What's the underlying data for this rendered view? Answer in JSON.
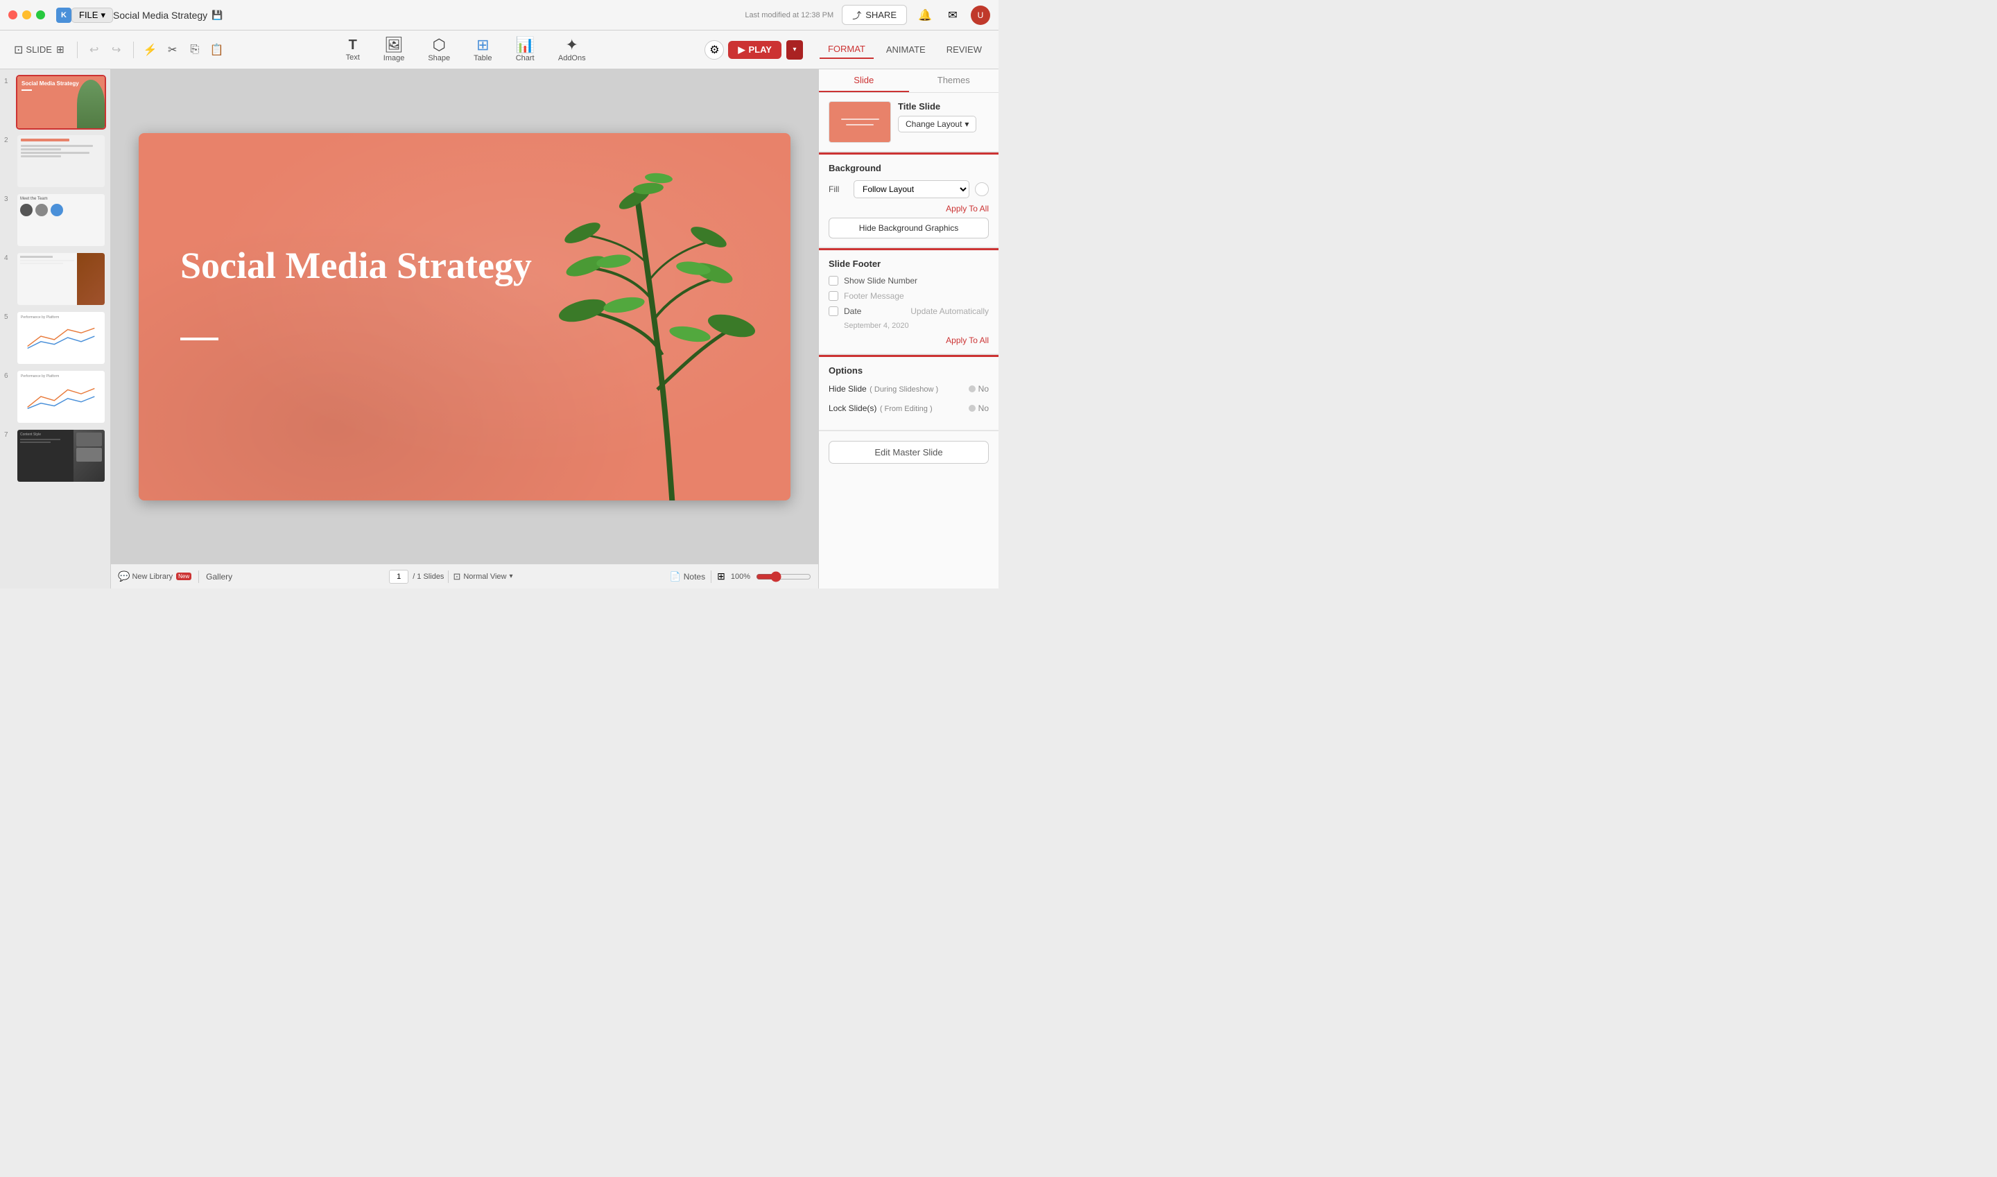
{
  "titlebar": {
    "app_icon": "K",
    "file_label": "FILE",
    "doc_title": "Social Media Strategy",
    "modified_text": "Last modified at 12:38 PM",
    "share_label": "SHARE"
  },
  "toolbar": {
    "slide_label": "SLIDE",
    "tools": [
      {
        "icon": "T",
        "label": "Text"
      },
      {
        "icon": "🖼",
        "label": "Image"
      },
      {
        "icon": "⬡",
        "label": "Shape"
      },
      {
        "icon": "⊞",
        "label": "Table"
      },
      {
        "icon": "📊",
        "label": "Chart"
      },
      {
        "icon": "✦",
        "label": "AddOns"
      }
    ],
    "play_label": "PLAY",
    "format_label": "FORMAT",
    "animate_label": "ANIMATE",
    "review_label": "REVIEW"
  },
  "slides": [
    {
      "num": 1,
      "type": "title",
      "selected": true
    },
    {
      "num": 2,
      "type": "text"
    },
    {
      "num": 3,
      "type": "team"
    },
    {
      "num": 4,
      "type": "image"
    },
    {
      "num": 5,
      "type": "chart"
    },
    {
      "num": 6,
      "type": "chart2"
    },
    {
      "num": 7,
      "type": "dark"
    }
  ],
  "slide_canvas": {
    "title": "Social Media Strategy"
  },
  "right_panel": {
    "tabs": {
      "slide_label": "Slide",
      "themes_label": "Themes"
    },
    "layout": {
      "title": "Title Slide",
      "change_layout_label": "Change Layout"
    },
    "background": {
      "section_title": "Background",
      "fill_label": "Fill",
      "follow_layout_label": "Follow Layout",
      "apply_to_all_label": "Apply To All",
      "hide_bg_label": "Hide Background Graphics"
    },
    "footer": {
      "section_title": "Slide Footer",
      "show_slide_number_label": "Show Slide Number",
      "footer_message_label": "Footer Message",
      "date_label": "Date",
      "update_auto_label": "Update Automatically",
      "date_value": "September 4, 2020",
      "apply_to_all_label": "Apply To All"
    },
    "options": {
      "section_title": "Options",
      "hide_slide_label": "Hide Slide",
      "hide_slide_sub": "( During Slideshow )",
      "lock_slide_label": "Lock Slide(s)",
      "lock_slide_sub": "( From Editing )",
      "no_label": "No"
    },
    "edit_master_label": "Edit Master Slide"
  },
  "status_bar": {
    "library_label": "New Library",
    "new_badge": "New",
    "gallery_label": "Gallery",
    "page_num": "1",
    "page_total": "/ 1 Slides",
    "normal_view_label": "Normal View",
    "notes_label": "Notes",
    "zoom_level": "100%"
  }
}
